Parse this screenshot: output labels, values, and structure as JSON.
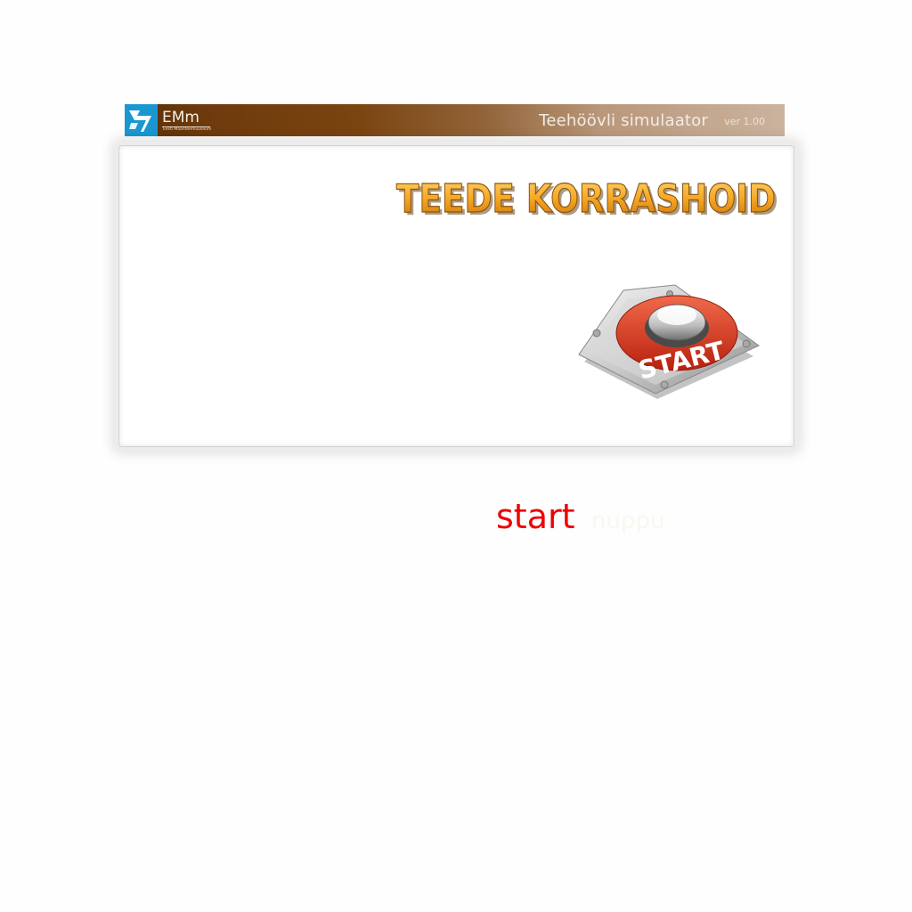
{
  "header": {
    "logo_text": "EMm",
    "logo_subtitle": "Eesti Maanteemuuseum",
    "app_title": "Teehöövli simulaator",
    "version": "ver 1.00"
  },
  "main": {
    "game_title": "TEEDE KORRASHOID",
    "start_button_label": "START",
    "start_link_label": "start",
    "start_hint": "nuppu"
  },
  "colors": {
    "header_brown": "#6e3a0c",
    "logo_blue": "#1a97d1",
    "title_orange": "#f5a623",
    "start_red": "#ee0000"
  },
  "icons": {
    "logo": "emm-logo-icon",
    "start": "start-button-icon"
  }
}
